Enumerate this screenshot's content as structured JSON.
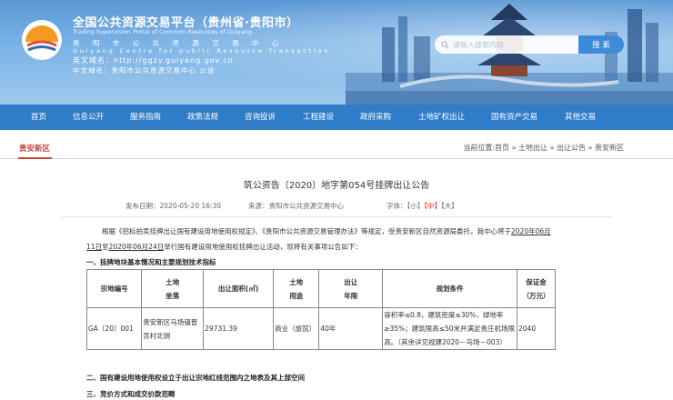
{
  "header": {
    "title_cn": "全国公共资源交易平台（贵州省·贵阳市）",
    "title_en": "Trading Supervision Portal of Common Resources of Guiyang",
    "line_cn": "贵 阳 市 公 共 资 源 交 易 中 心",
    "line_en": "Guiyang Centre for public Resource Transaction",
    "url_line": "英文域名：http://ggzy.guiyang.gov.cn",
    "cn_domain_line": "中文域名：贵阳市公共资源交易中心.公益"
  },
  "search": {
    "placeholder": "请输入搜索内容",
    "button": "搜 索"
  },
  "nav": [
    "首页",
    "信息公开",
    "服务指南",
    "政策法规",
    "咨询投诉",
    "工程建设",
    "政府采购",
    "土地矿权出让",
    "国有资产交易",
    "其他交易"
  ],
  "section": {
    "title": "贵安新区",
    "breadcrumb": "当前位置:首页 » 土地出让 » 出让公告 » 贵安新区"
  },
  "article": {
    "title": "筑公资告〔2020〕地字第054号挂牌出让公告",
    "date": "发布日期：2020-05-20 16:30",
    "source": "来源：贵阳市公共资源交易中心",
    "font_label": "字体：",
    "font_small": "【小】",
    "font_mid": "【中】",
    "font_big": "【大】",
    "intro_1": "根据《招标拍卖挂牌出让国有建设用地使用权规定》、《贵阳市公共资源交易管理办法》等规定，受贵安新区自然资源局委托，我中心将于",
    "intro_date_a": "2020年06月11日",
    "intro_mid": "至",
    "intro_date_b": "2020年06月24日",
    "intro_2": "举行国有建设用地使用权挂牌出让活动，现将有关事项公告如下：",
    "section1": "一、挂牌地块基本情况和主要规划技术指标",
    "section2": "二、国有建设用地使用权设立于出让宗地红线范围内之地表及其上部空间",
    "section3": "三、竞价方式和成交价款范畴"
  },
  "table": {
    "headers": [
      "宗地编号",
      "土地\n坐落",
      "出让面积(㎡)",
      "土地\n用途",
      "出让\n年限",
      "规划条件",
      "保证金\n（万元）"
    ],
    "row": [
      "GA〔20〕001",
      "贵安新区马场镇普贡村北侧",
      "29731.39",
      "商业（旅馆）",
      "40年",
      "容积率≤0.8，建筑密度≤30%，绿地率≥35%；建筑限高≤50米并满足贵庄机场限高。（其余详见规建2020－马场－003）",
      "2040"
    ]
  },
  "colors": {
    "nav": "#2f7dc9",
    "accent_red": "#c4463a",
    "banner": "#6aa8e2"
  }
}
